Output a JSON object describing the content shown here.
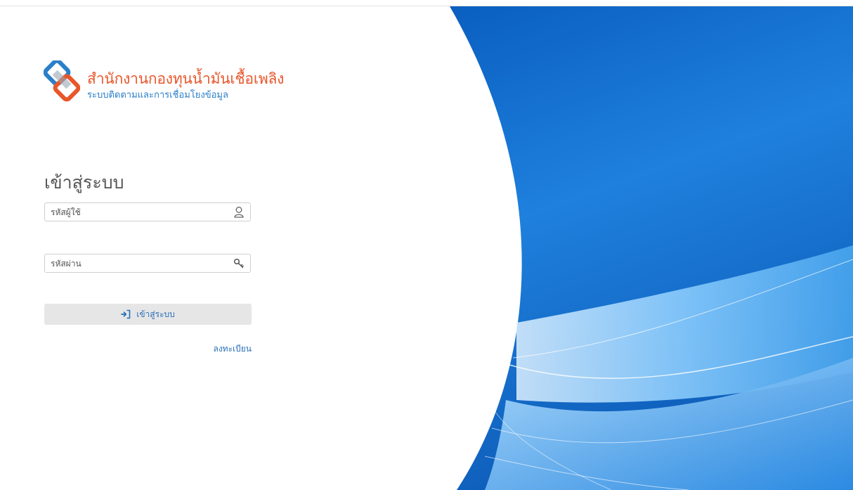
{
  "brand": {
    "title": "สำนักงานกองทุนน้ำมันเชื้อเพลิง",
    "subtitle": "ระบบติดตามและการเชื่อมโยงข้อมูล",
    "icon": "chain-link-logo"
  },
  "login": {
    "heading": "เข้าสู่ระบบ",
    "username": {
      "placeholder": "รหัสผู้ใช้",
      "value": "",
      "icon": "user-icon"
    },
    "password": {
      "placeholder": "รหัสผ่าน",
      "value": "",
      "icon": "key-icon"
    },
    "submit_label": "เข้าสู่ระบบ",
    "submit_icon": "sign-in-icon",
    "register_label": "ลงทะเบียน"
  },
  "colors": {
    "brand_orange": "#e8562a",
    "brand_blue": "#2a7fc8",
    "link_blue": "#2a6fb8",
    "background_blue": "#0a64c4"
  }
}
